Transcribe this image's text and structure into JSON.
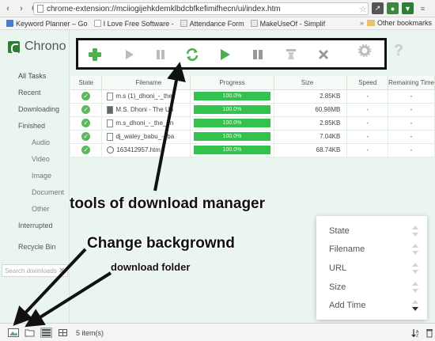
{
  "browser": {
    "url": "chrome-extension://mciiogijehkdemklbdcbfkefimifhecn/ui/index.htm",
    "bookmarks": [
      {
        "label": "Keyword Planner – Go",
        "color": "#4a7bd0"
      },
      {
        "label": "I Love Free Software -",
        "color": "#ffffff"
      },
      {
        "label": "Attendance Form",
        "color": "#e8e8e8"
      },
      {
        "label": "MakeUseOf - Simplif",
        "color": "#e8e8e8"
      }
    ],
    "other_bookmarks": "Other bookmarks"
  },
  "app": {
    "name": "Chrono",
    "brand_color": "#2e7d32"
  },
  "sidebar": {
    "items": [
      {
        "label": "All Tasks",
        "level": "main",
        "active": true
      },
      {
        "label": "Recent",
        "level": "main"
      },
      {
        "label": "Downloading",
        "level": "main"
      },
      {
        "label": "Finished",
        "level": "main"
      },
      {
        "label": "Audio",
        "level": "sub"
      },
      {
        "label": "Video",
        "level": "sub"
      },
      {
        "label": "Image",
        "level": "sub"
      },
      {
        "label": "Document",
        "level": "sub"
      },
      {
        "label": "Other",
        "level": "sub"
      },
      {
        "label": "Interrupted",
        "level": "main"
      },
      {
        "label": "Recycle Bin",
        "level": "main"
      }
    ],
    "search_placeholder": "Search downloads"
  },
  "toolbar": {
    "buttons": [
      "add-icon",
      "play-icon",
      "pause-icon",
      "refresh-icon",
      "start-all-icon",
      "open-icon",
      "clear-icon",
      "delete-icon"
    ]
  },
  "table": {
    "columns": [
      "State",
      "Filename",
      "Progress",
      "Size",
      "Speed",
      "Remaining Time"
    ],
    "rows": [
      {
        "filename": "m.s (1)_dhoni_-_the",
        "progress": 1.0,
        "progress_text": "100.0%",
        "size": "2.85KB",
        "speed": "-",
        "remaining": "-"
      },
      {
        "filename": "M.S. Dhoni - The Un",
        "progress": 1.0,
        "progress_text": "100.0%",
        "size": "60.98MB",
        "speed": "-",
        "remaining": "-"
      },
      {
        "filename": "m.s_dhoni_-_the_un",
        "progress": 1.0,
        "progress_text": "100.0%",
        "size": "2.85KB",
        "speed": "-",
        "remaining": "-"
      },
      {
        "filename": "dj_waley_babu_-_ba",
        "progress": 1.0,
        "progress_text": "100.0%",
        "size": "7.04KB",
        "speed": "-",
        "remaining": "-"
      },
      {
        "filename": "163412957.htm",
        "progress": 1.0,
        "progress_text": "100.0%",
        "size": "68.74KB",
        "speed": "-",
        "remaining": "-"
      }
    ]
  },
  "sort_menu": {
    "items": [
      "State",
      "Filename",
      "URL",
      "Size",
      "Add Time"
    ]
  },
  "status": {
    "item_count": "5 item(s)"
  },
  "annotations": {
    "tools": "tools of download manager",
    "background": "Change backgrownd",
    "folder": "download folder"
  }
}
